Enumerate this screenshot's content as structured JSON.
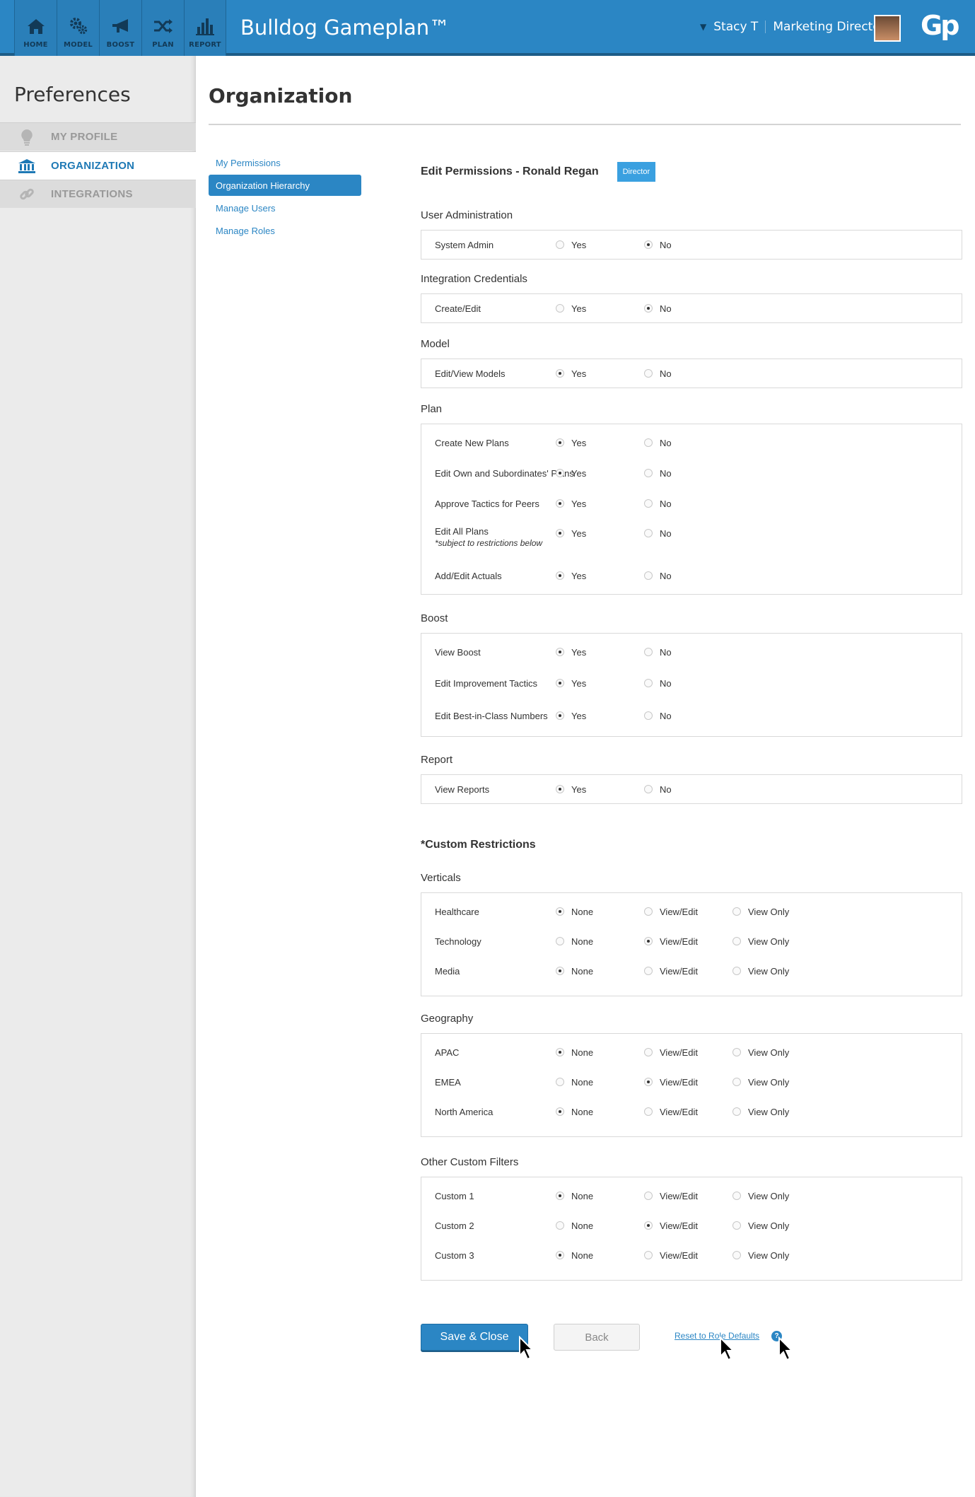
{
  "nav": {
    "items": [
      {
        "label": "HOME",
        "icon": "home-icon"
      },
      {
        "label": "MODEL",
        "icon": "gears-icon"
      },
      {
        "label": "BOOST",
        "icon": "megaphone-icon"
      },
      {
        "label": "PLAN",
        "icon": "shuffle-icon"
      },
      {
        "label": "REPORT",
        "icon": "bar-chart-icon"
      }
    ],
    "app_title": "Bulldog Gameplan™",
    "user_name": "Stacy T",
    "user_role": "Marketing Director",
    "logo_text": "Gp"
  },
  "sidebar": {
    "title": "Preferences",
    "items": [
      {
        "label": "MY PROFILE",
        "icon": "lightbulb-icon"
      },
      {
        "label": "ORGANIZATION",
        "icon": "institution-icon"
      },
      {
        "label": "INTEGRATIONS",
        "icon": "link-icon"
      }
    ]
  },
  "main": {
    "title": "Organization",
    "subnav": [
      "My Permissions",
      "Organization Hierarchy",
      "Manage Users",
      "Manage Roles"
    ],
    "edit_title": "Edit Permissions - Ronald Regan",
    "role_badge": "Director"
  },
  "options": {
    "yes": "Yes",
    "no": "No",
    "none": "None",
    "view_edit": "View/Edit",
    "view_only": "View Only"
  },
  "permissions": {
    "user_admin": {
      "title": "User Administration",
      "rows": [
        {
          "name": "System Admin",
          "value": "No"
        }
      ]
    },
    "integration": {
      "title": "Integration Credentials",
      "rows": [
        {
          "name": "Create/Edit",
          "value": "No"
        }
      ]
    },
    "model": {
      "title": "Model",
      "rows": [
        {
          "name": "Edit/View Models",
          "value": "Yes"
        }
      ]
    },
    "plan": {
      "title": "Plan",
      "rows": [
        {
          "name": "Create New Plans",
          "value": "Yes"
        },
        {
          "name": "Edit Own and Subordinates' Plans",
          "value": "Yes"
        },
        {
          "name": "Approve Tactics for Peers",
          "value": "Yes"
        },
        {
          "name": "Edit All Plans",
          "note": "*subject to restrictions below",
          "value": "Yes"
        },
        {
          "name": "Add/Edit Actuals",
          "value": "Yes"
        }
      ]
    },
    "boost": {
      "title": "Boost",
      "rows": [
        {
          "name": "View Boost",
          "value": "Yes"
        },
        {
          "name": "Edit Improvement Tactics",
          "value": "Yes"
        },
        {
          "name": "Edit Best-in-Class Numbers",
          "value": "Yes"
        }
      ]
    },
    "report": {
      "title": "Report",
      "rows": [
        {
          "name": "View Reports",
          "value": "Yes"
        }
      ]
    }
  },
  "custom": {
    "title": "*Custom Restrictions",
    "verticals": {
      "title": "Verticals",
      "rows": [
        {
          "name": "Healthcare",
          "value": "None"
        },
        {
          "name": "Technology",
          "value": "View/Edit"
        },
        {
          "name": "Media",
          "value": "None"
        }
      ]
    },
    "geography": {
      "title": "Geography",
      "rows": [
        {
          "name": "APAC",
          "value": "None"
        },
        {
          "name": "EMEA",
          "value": "View/Edit"
        },
        {
          "name": "North America",
          "value": "None"
        }
      ]
    },
    "other": {
      "title": "Other Custom Filters",
      "rows": [
        {
          "name": "Custom 1",
          "value": "None"
        },
        {
          "name": "Custom 2",
          "value": "View/Edit"
        },
        {
          "name": "Custom 3",
          "value": "None"
        }
      ]
    }
  },
  "actions": {
    "save": "Save & Close",
    "back": "Back",
    "reset": "Reset to Role Defaults",
    "help": "?"
  },
  "colors": {
    "brand": "#2b86c4",
    "badge": "#3aa0e0",
    "sidebar_bg": "#ebebeb"
  }
}
